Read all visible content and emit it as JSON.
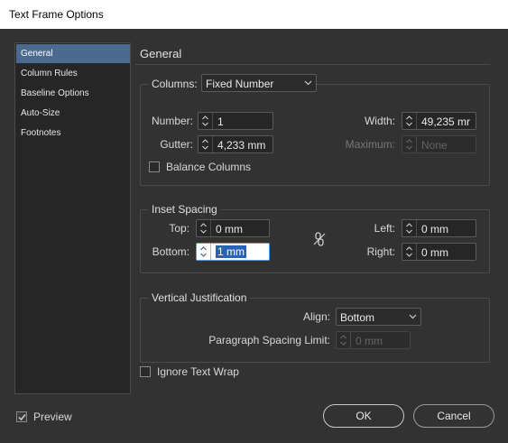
{
  "window": {
    "title": "Text Frame Options"
  },
  "nav": {
    "items": [
      {
        "label": "General",
        "selected": true
      },
      {
        "label": "Column Rules"
      },
      {
        "label": "Baseline Options"
      },
      {
        "label": "Auto-Size"
      },
      {
        "label": "Footnotes"
      }
    ]
  },
  "general": {
    "heading": "General",
    "columns": {
      "label": "Columns:",
      "type_value": "Fixed Number",
      "number_label": "Number:",
      "number_value": "1",
      "gutter_label": "Gutter:",
      "gutter_value": "4,233 mm",
      "width_label": "Width:",
      "width_value": "49,235 mr",
      "maximum_label": "Maximum:",
      "maximum_value": "None",
      "balance_label": "Balance Columns",
      "balance_checked": false
    },
    "inset": {
      "label": "Inset Spacing",
      "top_label": "Top:",
      "top_value": "0 mm",
      "bottom_label": "Bottom:",
      "bottom_value": "1 mm",
      "left_label": "Left:",
      "left_value": "0 mm",
      "right_label": "Right:",
      "right_value": "0 mm"
    },
    "vertical": {
      "label": "Vertical Justification",
      "align_label": "Align:",
      "align_value": "Bottom",
      "spacing_label": "Paragraph Spacing Limit:",
      "spacing_value": "0 mm"
    },
    "ignore_wrap_label": "Ignore Text Wrap",
    "ignore_wrap_checked": false
  },
  "footer": {
    "preview_label": "Preview",
    "preview_checked": true,
    "ok_label": "OK",
    "cancel_label": "Cancel"
  }
}
